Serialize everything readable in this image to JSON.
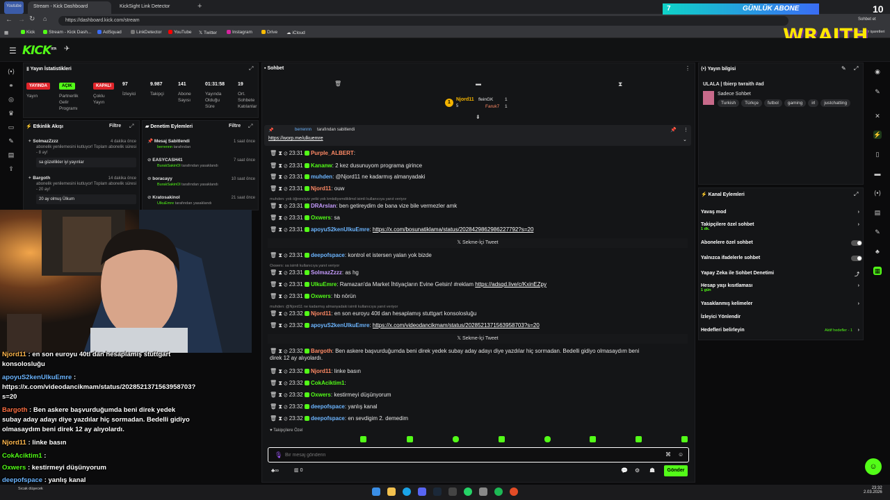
{
  "browser": {
    "youtube_label": "Youtube",
    "tabs": [
      "Stream - Kick Dashboard",
      "KickSight Link Detector"
    ],
    "url": "https://dashboard.kick.com/stream",
    "bookmarks": [
      "Kick",
      "Stream - Kick Dash...",
      "AdSquad",
      "LinkDetector",
      "YouTube",
      "Twitter",
      "Instagram",
      "Drive",
      "iCloud"
    ],
    "top_right_label": "Sohbet et",
    "top_right_label2": "Tüm yer işaretleri"
  },
  "overlay_top": {
    "sub_count": "7",
    "sub_label": "GÜNLÜK ABONE",
    "counter": "10",
    "brand": "WRAITH"
  },
  "header": {
    "logo": "KICK",
    "logo_sup": "BETA"
  },
  "stats": {
    "title": "Yayın İstatistikleri",
    "items": [
      {
        "badge": "YAYINDA",
        "label": "Yayın",
        "color": "#e0242a"
      },
      {
        "badge": "AÇIK",
        "label": "Partnerlik Gelir Programı",
        "color": "#53fc18"
      },
      {
        "badge": "KAPALI",
        "label": "Çoklu Yayın",
        "color": "#e0242a"
      },
      {
        "value": "97",
        "label": "İzleyici"
      },
      {
        "value": "9.987",
        "label": "Takipçi"
      },
      {
        "value": "141",
        "label": "Abone Sayısı"
      },
      {
        "value": "01:31:58",
        "label": "Yayında Olduğu Süre"
      },
      {
        "value": "19",
        "label": "Ort. Sohbete Katılanlar"
      }
    ]
  },
  "activity": {
    "title": "Etkinlik Akışı",
    "filter": "Filtre",
    "items": [
      {
        "user": "SolmazZzzz",
        "time": "4 dakika önce",
        "text": "abonelik yenilemesini kutluyor! Toplam abonelik süresi - 8 ay!",
        "msg": "sa güzellikler iyi yayınlar"
      },
      {
        "user": "Bargoth",
        "time": "14 dakika önce",
        "text": "abonelik yenilemesini kutluyor! Toplam abonelik süresi - 20 ay!",
        "msg": "20 ay olmuş Ülkum"
      }
    ]
  },
  "mod": {
    "title": "Denetim Eylemleri",
    "filter": "Filtre",
    "items": [
      {
        "title": "Mesaj Sabitlendi",
        "user": "berrennn",
        "suffix": "tarafından",
        "time": "1 saat önce"
      },
      {
        "title": "EASYCASH41",
        "user": "BurakSakinOl",
        "suffix": "tarafından yasaklandı",
        "time": "7 saat önce"
      },
      {
        "title": "boracayy",
        "user": "BurakSakinOl",
        "suffix": "tarafından yasaklandı",
        "time": "10 saat önce"
      },
      {
        "title": "Kratosakinol",
        "user": "UlkuEmre",
        "suffix": "tarafından yasaklandı",
        "time": "21 saat önce"
      }
    ]
  },
  "chat": {
    "title": "Sohbet",
    "leaderboard": {
      "first": "Njord11",
      "first_count": "5",
      "second": "fleinGK",
      "second_count": "1",
      "third": "Faruk7",
      "third_count": "1"
    },
    "pinned": {
      "by_user": "berrennn",
      "by_suffix": "tarafından sabitlendi",
      "link": "https://worp.me/ulkuemre"
    },
    "messages": [
      {
        "time": "23:31",
        "user": "Purple_ALBERT",
        "text": "",
        "ucls": "u-orange"
      },
      {
        "time": "23:31",
        "user": "Kananw",
        "text": "2 kez dusunuyom programa girince",
        "ucls": "u-green"
      },
      {
        "time": "23:31",
        "user": "muhden",
        "text": "@Njord11 ne kadarmış almanyadaki",
        "ucls": "u-blue"
      },
      {
        "time": "23:31",
        "user": "Njord11",
        "text": "ouw",
        "ucls": "u-orange"
      },
      {
        "time": "23:31",
        "user": "DRArslan",
        "text": "ben getireydim de bana vize bile vermezler amk",
        "ucls": "u-purple",
        "reply": "muhden: yok öğrenciyiz yetki yok kmkdiysmdiklimd isimli kullanıcıya yanıt veriyor"
      },
      {
        "time": "23:31",
        "user": "Oxwers",
        "text": "sa",
        "ucls": "u-green"
      },
      {
        "time": "23:31",
        "user": "apoyuS2kenUlkuEmre",
        "text": "",
        "link": "https://x.com/bosunatiklama/status/2028429862986227792?s=20",
        "ucls": "u-blue"
      },
      {
        "time": "23:31",
        "user": "deepofspace",
        "text": "kontrol et istersen yalan yok bizde",
        "ucls": "u-blue"
      },
      {
        "time": "23:31",
        "user": "SolmazZzzz",
        "text": "as hg",
        "ucls": "u-purple",
        "reply": "Oxwers: sa isimli kullanıcıya yanıt veriyor"
      },
      {
        "time": "23:31",
        "user": "UlkuEmre",
        "text": "Ramazan'da Market İhtiyaçların Evine Gelsin! #reklam ",
        "link": "https://adsqd.live/c/KxinEZpy",
        "ucls": "u-green"
      },
      {
        "time": "23:31",
        "user": "Oxwers",
        "text": "hb nörün",
        "ucls": "u-green"
      },
      {
        "time": "23:32",
        "user": "Njord11",
        "text": "en son euroyu 40tl dan hesaplamış stuttgart konsolosluğu",
        "ucls": "u-orange",
        "reply": "muhden: @Njord11 ne kadarmış almanyadaki isimli kullanıcıya yanıt veriyor"
      },
      {
        "time": "23:32",
        "user": "apoyuS2kenUlkuEmre",
        "text": "",
        "link": "https://x.com/videodancikmam/status/2028521371563958703?s=20",
        "ucls": "u-blue"
      },
      {
        "time": "23:32",
        "user": "Bargoth",
        "text": "Ben askere başvurduğumda beni direk yedek subay aday adayı diye yazdılar hiç sormadan. Bedelli gidiyo olmasaydım beni",
        "text2": "direk 12 ay alıyolardı.",
        "ucls": "u-orange"
      },
      {
        "time": "23:32",
        "user": "Njord11",
        "text": "linke basın",
        "ucls": "u-orange"
      },
      {
        "time": "23:32",
        "user": "CokAciktim1",
        "text": "",
        "ucls": "u-green"
      },
      {
        "time": "23:32",
        "user": "Oxwers",
        "text": "kestirmeyi düşünyorum",
        "ucls": "u-green"
      },
      {
        "time": "23:32",
        "user": "deepofspace",
        "text": "yanlış kanal",
        "ucls": "u-blue"
      },
      {
        "time": "23:32",
        "user": "deepofspace",
        "text": "en sevdigim 2. demedim",
        "ucls": "u-blue"
      }
    ],
    "tweet_label": "Sekme-İçi Tweet",
    "followers_label": "Takipçilere Özel",
    "input_placeholder": "Bir mesaj gönderin",
    "points": "0",
    "send": "Gönder"
  },
  "info": {
    "title": "Yayın bilgisi",
    "stream_title": "ULALA | tbierp twraith #ad",
    "category": "Sadece Sohbet",
    "tags": [
      "Turkish",
      "Türkçe",
      "futbol",
      "gaming",
      "irl",
      "justchatting"
    ]
  },
  "channel": {
    "title": "Kanal Eylemleri",
    "rows": [
      {
        "label": "Yavaş mod",
        "kind": "chev"
      },
      {
        "label": "Takipçilere özel sohbet",
        "sub": "1 dk.",
        "kind": "chev"
      },
      {
        "label": "Abonelere özel sohbet",
        "kind": "toggle"
      },
      {
        "label": "Yalnızca ifadelerle sohbet",
        "kind": "toggle"
      },
      {
        "label": "Yapay Zeka ile Sohbet Denetimi",
        "kind": "ext"
      },
      {
        "label": "Hesap yaşı kısıtlaması",
        "sub": "1 gün",
        "kind": "chev"
      },
      {
        "label": "Yasaklanmış kelimeler",
        "kind": "chev"
      },
      {
        "label": "İzleyici Yönlendir",
        "kind": "none"
      },
      {
        "label": "Hedefleri belirleyin",
        "extra": "Aktif hedefler - 1",
        "kind": "chev"
      }
    ]
  },
  "overlay_chat": [
    {
      "user": "Njord11",
      "text": " : en son euroyu 40tl dan hesaplamış stuttgart",
      "color": "#ffb74d"
    },
    {
      "user": "",
      "text": "konsolosluğu",
      "color": "#fff"
    },
    {
      "user": "apoyuS2kenUlkuEmre",
      "text": " :",
      "color": "#6cb5ff"
    },
    {
      "user": "",
      "text": "https://x.com/videodancikmam/status/2028521371563958703?",
      "color": "#fff"
    },
    {
      "user": "",
      "text": "s=20",
      "color": "#fff"
    },
    {
      "user": "Bargoth",
      "text": " : Ben askere başvurduğumda beni direk yedek",
      "color": "#ff7043"
    },
    {
      "user": "",
      "text": "subay aday adayı diye yazdılar hiç sormadan. Bedelli gidiyo",
      "color": "#fff"
    },
    {
      "user": "",
      "text": "olmasaydım beni direk 12 ay alıyolardı.",
      "color": "#fff"
    },
    {
      "user": "Njord11",
      "text": " : linke basın",
      "color": "#ffb74d"
    },
    {
      "user": "CokAciktim1",
      "text": " :",
      "color": "#53fc18"
    },
    {
      "user": "Oxwers",
      "text": " : kestirmeyi düşünyorum",
      "color": "#53fc18"
    },
    {
      "user": "deepofspace",
      "text": " : yanlış kanal",
      "color": "#6cb5ff"
    },
    {
      "user": "deepofspace",
      "text": " : en sevdigim 2. demedim",
      "color": "#6cb5ff"
    }
  ],
  "taskbar": {
    "time": "23:32",
    "date": "2.03.2026",
    "weather": "Sıcak düşecek"
  }
}
